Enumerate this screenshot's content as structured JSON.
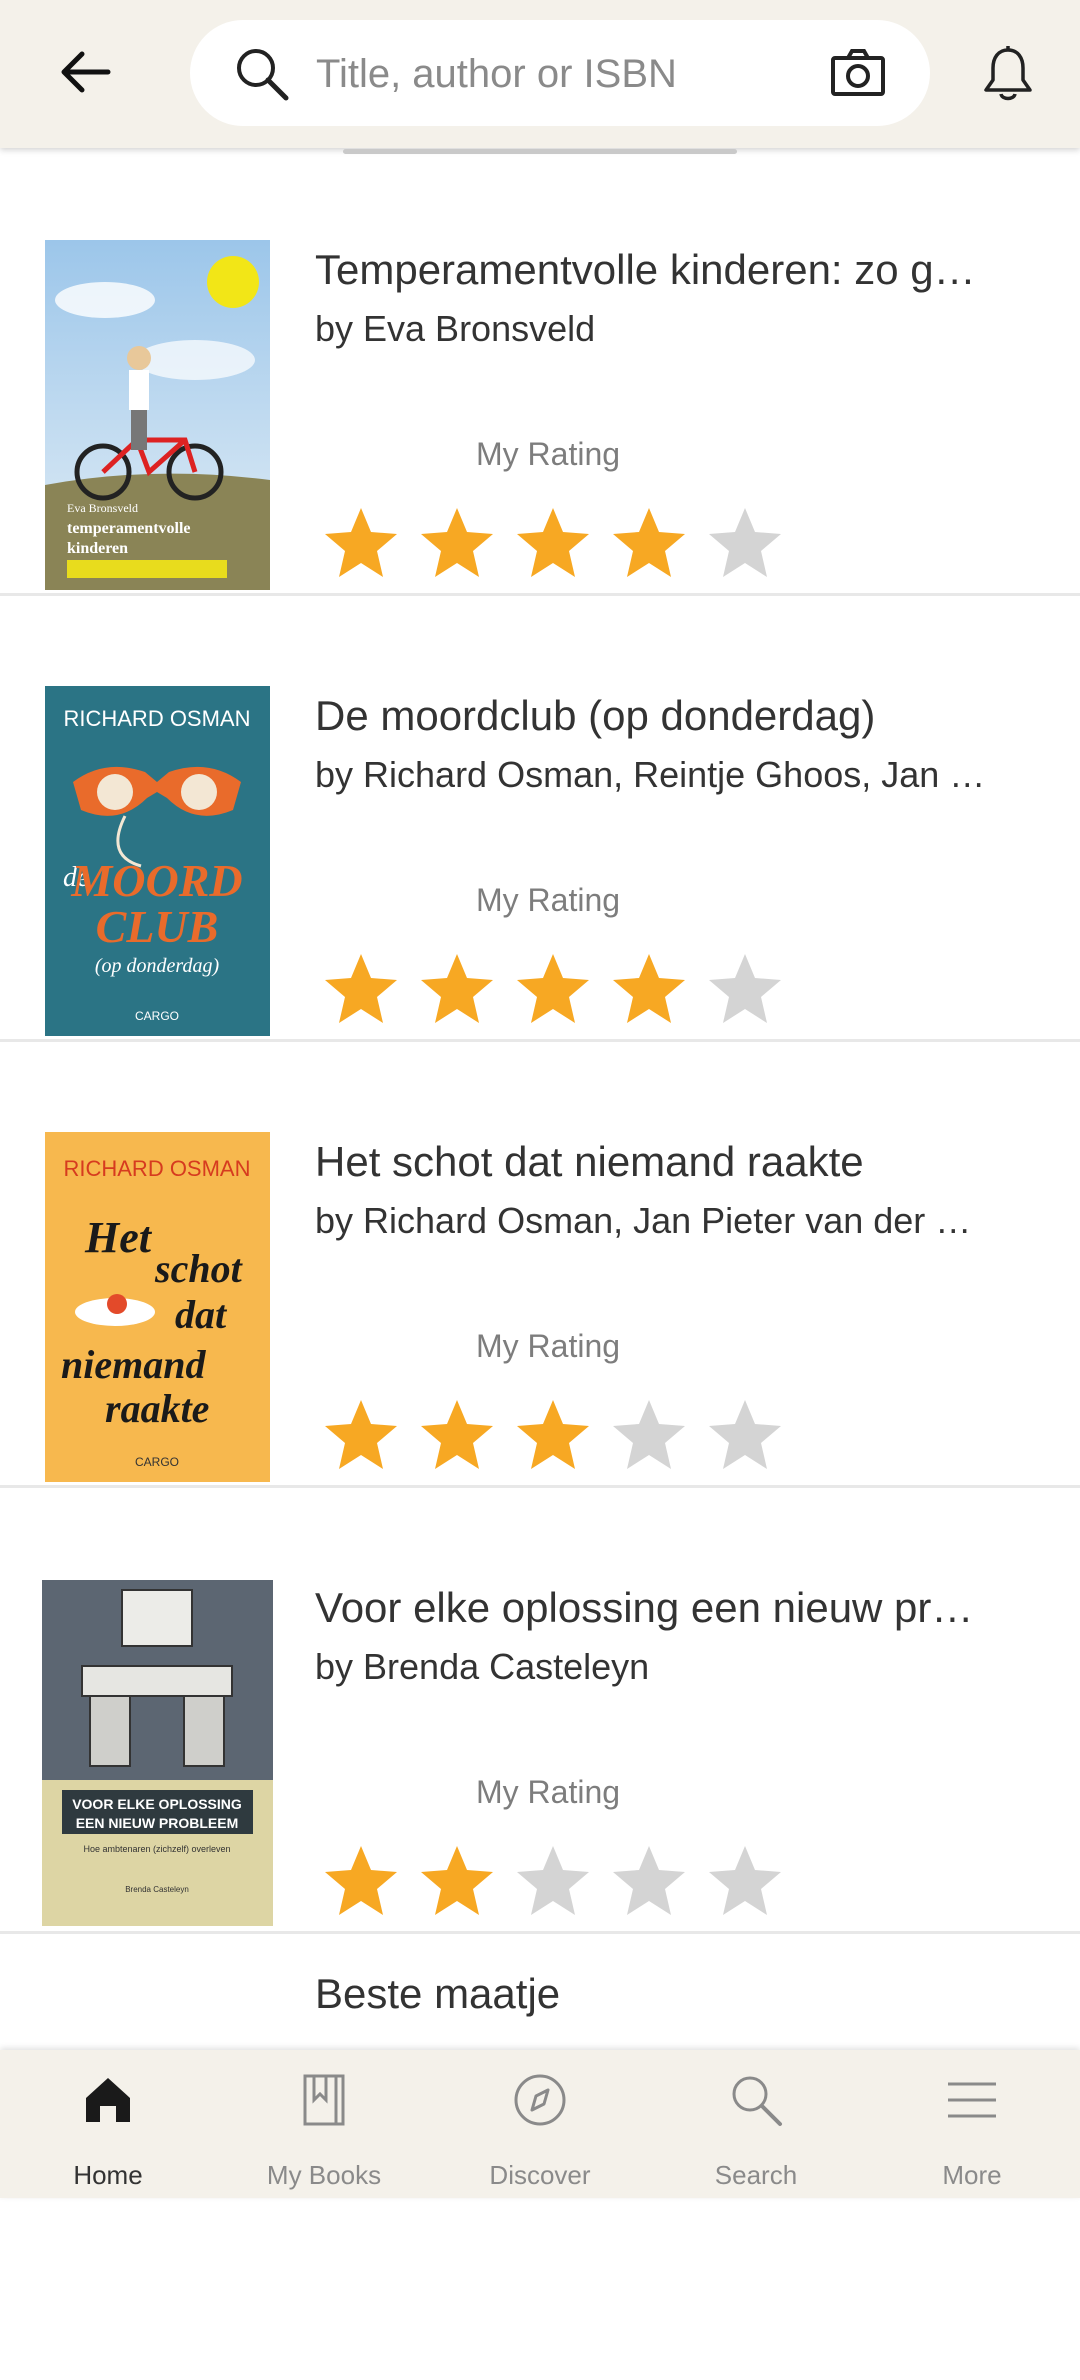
{
  "search": {
    "placeholder": "Title, author or ISBN"
  },
  "books": [
    {
      "title": "Temperamentvolle kinderen: zo g…",
      "author": "by Eva Bronsveld",
      "rating_label": "My Rating",
      "rating": 4,
      "cover": {
        "bg": "#b9d4ea",
        "text_top": "Eva Bronsveld",
        "text_main": "temperamentvolle kinderen"
      }
    },
    {
      "title": "De moordclub (op donderdag)",
      "author": "by Richard Osman, Reintje Ghoos, Jan …",
      "rating_label": "My Rating",
      "rating": 4,
      "cover": {
        "bg": "#2b7485",
        "text_top": "RICHARD OSMAN",
        "text_main": "de MOORD CLUB",
        "text_sub": "(op donderdag)",
        "text_pub": "CARGO"
      }
    },
    {
      "title": "Het schot dat niemand raakte",
      "author": "by Richard Osman, Jan Pieter van der …",
      "rating_label": "My Rating",
      "rating": 3,
      "cover": {
        "bg": "#f7b84e",
        "text_top": "RICHARD OSMAN",
        "text_main": "Het schot dat niemand raakte",
        "text_pub": "CARGO"
      }
    },
    {
      "title": "Voor elke oplossing een nieuw pr…",
      "author": "by Brenda Casteleyn",
      "rating_label": "My Rating",
      "rating": 2,
      "cover": {
        "bg": "#ddd5a4",
        "text_main": "VOOR ELKE OPLOSSING EEN NIEUW PROBLEEM",
        "text_sub": "Hoe ambtenaren (zichzelf) overleven",
        "text_pub": "Brenda Casteleyn"
      }
    }
  ],
  "partial_row_title": "Beste maatje",
  "colors": {
    "star_filled": "#f7a823",
    "star_empty": "#d4d4d4",
    "header_bg": "#f4f1ea"
  },
  "nav": [
    {
      "label": "Home",
      "icon": "home-icon",
      "active": true
    },
    {
      "label": "My Books",
      "icon": "my-books-icon"
    },
    {
      "label": "Discover",
      "icon": "compass-icon"
    },
    {
      "label": "Search",
      "icon": "search-icon"
    },
    {
      "label": "More",
      "icon": "menu-icon"
    }
  ]
}
